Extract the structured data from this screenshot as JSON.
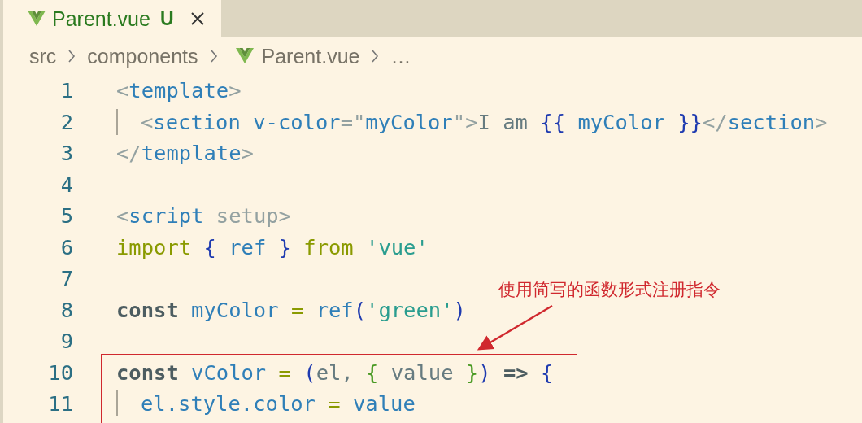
{
  "tabs": [
    {
      "label": "Parent.vue",
      "status": "U",
      "selected": true
    }
  ],
  "breadcrumb": [
    {
      "label": "src",
      "kind": "folder"
    },
    {
      "label": "components",
      "kind": "folder"
    },
    {
      "label": "Parent.vue",
      "kind": "vue"
    },
    {
      "label": "…",
      "kind": "more"
    }
  ],
  "lines": [
    {
      "number": "1",
      "guide": false,
      "tokens": [
        {
          "text": "<",
          "kind": "punct"
        },
        {
          "text": "template",
          "kind": "tag"
        },
        {
          "text": ">",
          "kind": "punct"
        }
      ]
    },
    {
      "number": "2",
      "guide": true,
      "tokens": [
        {
          "text": "<",
          "kind": "punct"
        },
        {
          "text": "section",
          "kind": "tag"
        },
        {
          "text": "v-color",
          "kind": "tag",
          "space_before": true
        },
        {
          "text": "=\"",
          "kind": "punct"
        },
        {
          "text": "myColor",
          "kind": "tag"
        },
        {
          "text": "\">",
          "kind": "punct"
        },
        {
          "text": "I am",
          "kind": "text"
        },
        {
          "text": "{{",
          "kind": "brace",
          "space_before": true
        },
        {
          "text": "myColor",
          "kind": "tag",
          "space_before": true
        },
        {
          "text": "}}",
          "kind": "brace",
          "space_before": true
        },
        {
          "text": "</",
          "kind": "punct"
        },
        {
          "text": "section",
          "kind": "tag"
        },
        {
          "text": ">",
          "kind": "punct"
        }
      ]
    },
    {
      "number": "3",
      "guide": false,
      "tokens": [
        {
          "text": "</",
          "kind": "punct"
        },
        {
          "text": "template",
          "kind": "tag"
        },
        {
          "text": ">",
          "kind": "punct"
        }
      ]
    },
    {
      "number": "4",
      "guide": false
    },
    {
      "number": "5",
      "guide": false,
      "tokens": [
        {
          "text": "<",
          "kind": "punct"
        },
        {
          "text": "script",
          "kind": "tag"
        },
        {
          "text": "setup>",
          "kind": "punct",
          "space_before": true
        }
      ]
    },
    {
      "number": "6",
      "guide": false,
      "tokens": [
        {
          "text": "import",
          "kind": "keyword"
        },
        {
          "text": "{",
          "kind": "brace",
          "space_before": true
        },
        {
          "text": "ref",
          "kind": "tag",
          "space_before": true
        },
        {
          "text": "}",
          "kind": "brace",
          "space_before": true
        },
        {
          "text": "from",
          "kind": "keyword",
          "space_before": true
        },
        {
          "text": "'vue'",
          "kind": "string",
          "space_before": true
        }
      ]
    },
    {
      "number": "7",
      "guide": false
    },
    {
      "number": "8",
      "guide": false,
      "tokens": [
        {
          "text": "const",
          "kind": "storage"
        },
        {
          "text": "myColor",
          "kind": "tag",
          "space_before": true
        },
        {
          "text": "=",
          "kind": "keyword",
          "space_before": true
        },
        {
          "text": "ref",
          "kind": "tag",
          "space_before": true
        },
        {
          "text": "(",
          "kind": "brace"
        },
        {
          "text": "'green'",
          "kind": "string"
        },
        {
          "text": ")",
          "kind": "brace"
        }
      ]
    },
    {
      "number": "9",
      "guide": false
    },
    {
      "number": "10",
      "guide": false,
      "tokens": [
        {
          "text": "const",
          "kind": "storage"
        },
        {
          "text": "vColor",
          "kind": "tag",
          "space_before": true
        },
        {
          "text": "=",
          "kind": "keyword",
          "space_before": true
        },
        {
          "text": "(",
          "kind": "brace",
          "space_before": true
        },
        {
          "text": "el,",
          "kind": "text"
        },
        {
          "text": "{",
          "kind": "green",
          "space_before": true
        },
        {
          "text": "value",
          "kind": "text",
          "space_before": true
        },
        {
          "text": "}",
          "kind": "green",
          "space_before": true
        },
        {
          "text": ")",
          "kind": "brace"
        },
        {
          "text": "=>",
          "kind": "storage",
          "space_before": true
        },
        {
          "text": "{",
          "kind": "brace",
          "space_before": true
        }
      ]
    },
    {
      "number": "11",
      "guide": true,
      "tokens": [
        {
          "text": "el.style.color",
          "kind": "tag"
        },
        {
          "text": "=",
          "kind": "keyword",
          "space_before": true
        },
        {
          "text": "value",
          "kind": "tag",
          "space_before": true
        }
      ]
    }
  ],
  "annotation": {
    "text": "使用简写的函数形式注册指令"
  }
}
